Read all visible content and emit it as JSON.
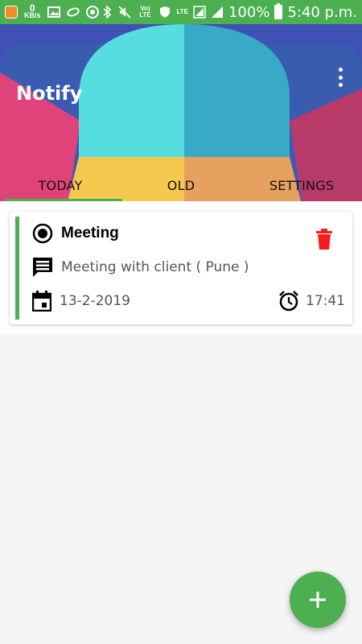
{
  "status_bar": {
    "speed_value": "0",
    "speed_unit": "KB/s",
    "volte_label": "Vo) LTE",
    "lte_label": "LTE",
    "battery_percent": "100%",
    "time": "5:40 p.m."
  },
  "app": {
    "title": "Notify",
    "menu_icon": "more-vert-icon"
  },
  "tabs": [
    {
      "label": "TODAY",
      "selected": true
    },
    {
      "label": "OLD",
      "selected": false
    },
    {
      "label": "SETTINGS",
      "selected": false
    }
  ],
  "notes": [
    {
      "title": "Meeting",
      "description": "Meeting with client ( Pune )",
      "date": "13-2-2019",
      "time": "17:41"
    }
  ],
  "colors": {
    "accent": "#4caf50",
    "delete": "#f41c1c",
    "header_teal_light": "#56dde0",
    "header_teal_dark": "#38a9c6",
    "header_pink": "#e0427a",
    "header_yellow": "#f5c84e",
    "header_orange": "#e6a060"
  },
  "fab": {
    "label": "+",
    "icon": "add-icon"
  }
}
